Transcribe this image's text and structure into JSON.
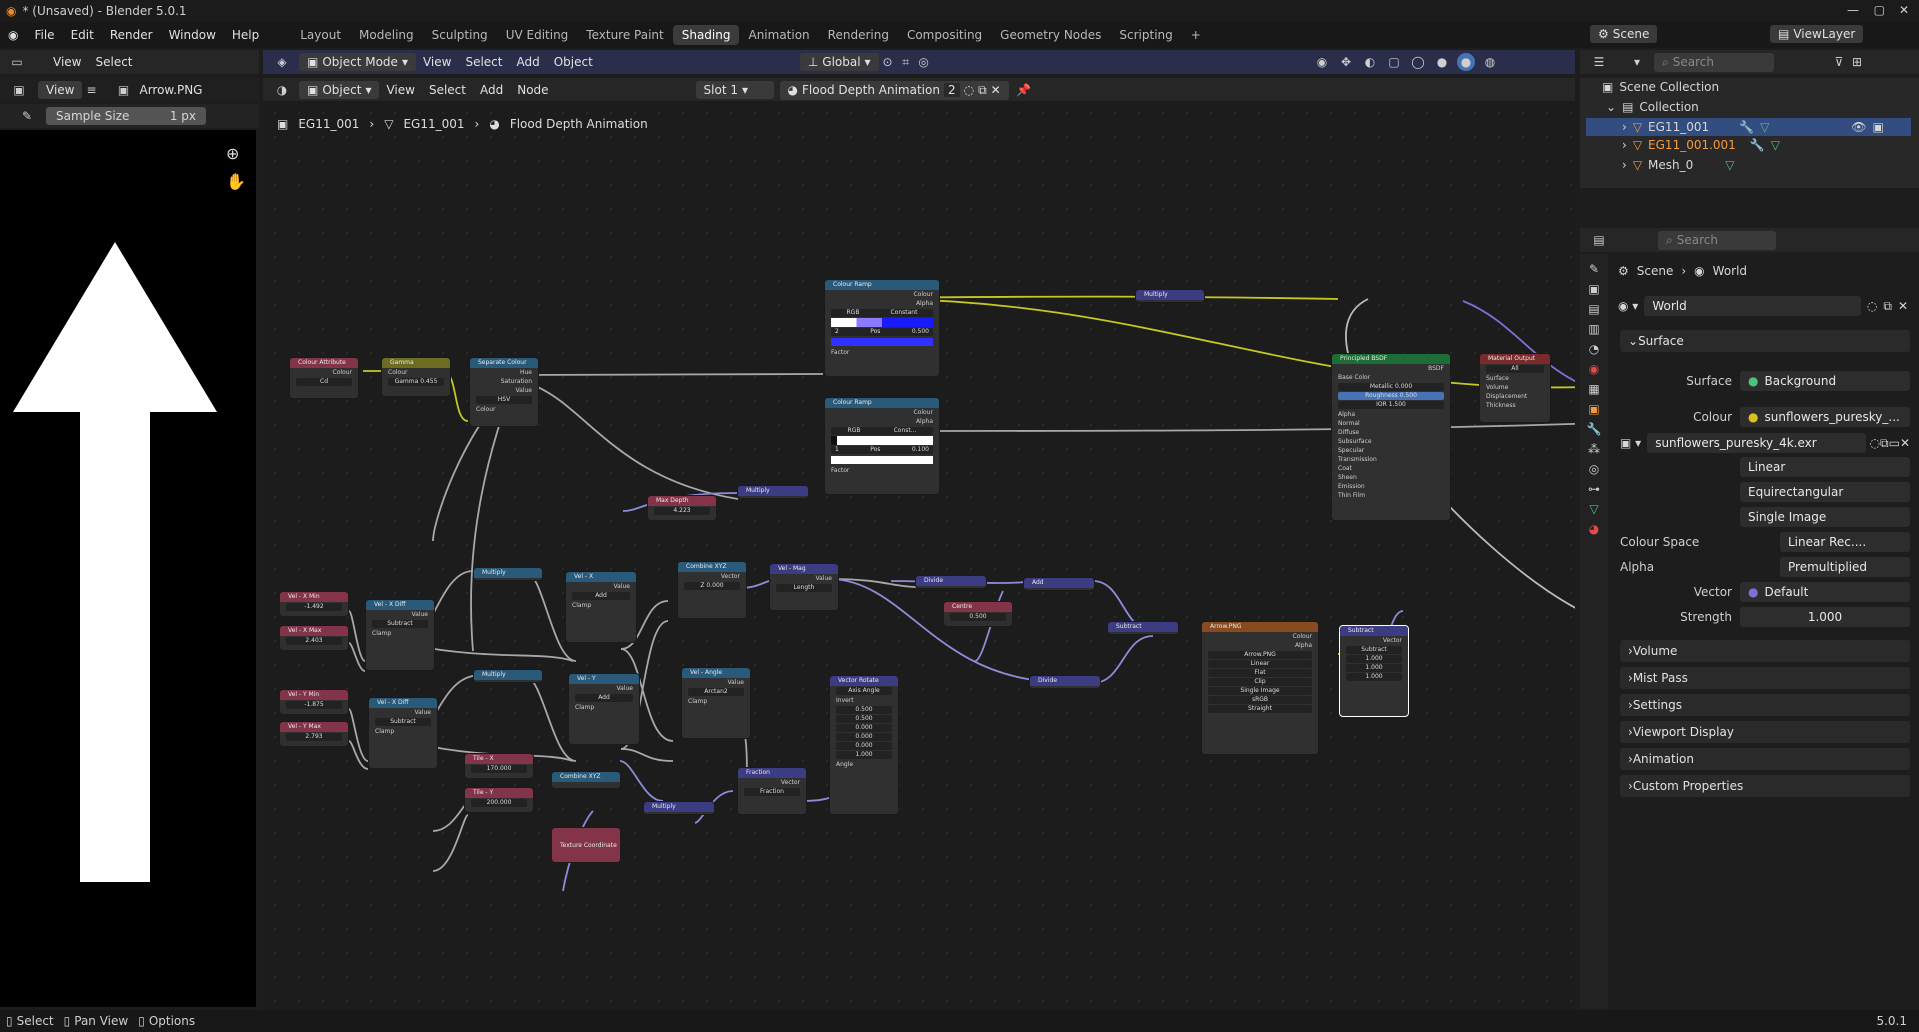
{
  "window_title": "* (Unsaved) - Blender 5.0.1",
  "menu": [
    "File",
    "Edit",
    "Render",
    "Window",
    "Help"
  ],
  "workspaces": [
    "Layout",
    "Modeling",
    "Sculpting",
    "UV Editing",
    "Texture Paint",
    "Shading",
    "Animation",
    "Rendering",
    "Compositing",
    "Geometry Nodes",
    "Scripting"
  ],
  "active_workspace": "Shading",
  "top_right": {
    "scene": "Scene",
    "view_layer": "ViewLayer"
  },
  "image_editor": {
    "header": {
      "view": "View",
      "select": "Select"
    },
    "sub_header": {
      "view": "View",
      "image_name": "Arrow.PNG"
    },
    "sample_size_label": "Sample Size",
    "sample_size_value": "1 px"
  },
  "viewport_header": {
    "mode": "Object Mode",
    "menus": [
      "View",
      "Select",
      "Add",
      "Object"
    ],
    "orientation": "Global"
  },
  "node_header": {
    "type": "Object",
    "menus": [
      "View",
      "Select",
      "Add",
      "Node"
    ],
    "slot": "Slot 1",
    "material": "Flood Depth Animation",
    "users": "2"
  },
  "breadcrumb": [
    "EG11_001",
    "EG11_001",
    "Flood Depth Animation"
  ],
  "nodes": {
    "colour_attribute": {
      "title": "Colour Attribute",
      "out1": "Colour",
      "out2": "Alpha",
      "field": "Cd"
    },
    "gamma": {
      "title": "Gamma",
      "in": "Colour",
      "gamma": "Gamma 0.455"
    },
    "separate_colour": {
      "title": "Separate Colour",
      "out1": "Hue",
      "out2": "Saturation",
      "out3": "Value",
      "mode": "HSV",
      "in": "Colour"
    },
    "colour_ramp_1": {
      "title": "Colour Ramp",
      "out1": "Colour",
      "out2": "Alpha",
      "mode": "RGB",
      "interp": "Constant",
      "pos_index": "2",
      "pos_label": "Pos",
      "pos_value": "0.500",
      "in": "Factor"
    },
    "colour_ramp_2": {
      "title": "Colour Ramp",
      "out1": "Colour",
      "out2": "Alpha",
      "mode": "RGB",
      "interp": "Const...",
      "pos_index": "1",
      "pos_label": "Pos",
      "pos_value": "0.100",
      "in": "Factor"
    },
    "multiply_top": {
      "title": "Multiply"
    },
    "principled": {
      "title": "Principled BSDF",
      "out": "BSDF",
      "rows": [
        "Base Color",
        "Metallic 0.000",
        "Roughness 0.500",
        "IOR 1.500",
        "Alpha",
        "Normal",
        "Diffuse",
        "Subsurface",
        "Specular",
        "Transmission",
        "Coat",
        "Sheen",
        "Emission",
        "Thin Film"
      ]
    },
    "material_output": {
      "title": "Material Output",
      "target": "All",
      "rows": [
        "Surface",
        "Volume",
        "Displacement",
        "Thickness"
      ]
    },
    "max_depth": {
      "title": "Max Depth",
      "value": "4.223"
    },
    "multiply_mid": {
      "title": "Multiply"
    },
    "vel_x_min": {
      "title": "Vel - X Min",
      "value": "-1.492"
    },
    "vel_x_max": {
      "title": "Vel - X Max",
      "value": "2.403"
    },
    "vel_y_min": {
      "title": "Vel - Y Min",
      "value": "-1.875"
    },
    "vel_y_max": {
      "title": "Vel - Y Max",
      "value": "2.793"
    },
    "vel_x_diff": {
      "title": "Vel - X Diff",
      "op": "Subtract",
      "clamp": "Clamp",
      "out": "Value"
    },
    "vel_y_diff": {
      "title": "Vel - X Diff",
      "op": "Subtract",
      "clamp": "Clamp",
      "out": "Value"
    },
    "multiply_a": {
      "title": "Multiply"
    },
    "multiply_b": {
      "title": "Multiply"
    },
    "vel_x": {
      "title": "Vel - X",
      "op": "Add",
      "clamp": "Clamp",
      "out": "Value"
    },
    "vel_y": {
      "title": "Vel - Y",
      "op": "Add",
      "clamp": "Clamp",
      "out": "Value"
    },
    "combine_xyz_1": {
      "title": "Combine XYZ",
      "out": "Vector",
      "z": "Z 0.000"
    },
    "vel_mag": {
      "title": "Vel - Mag",
      "op": "Length",
      "out": "Value"
    },
    "vel_angle": {
      "title": "Vel - Angle",
      "op": "Arctan2",
      "clamp": "Clamp",
      "out": "Value"
    },
    "tile_x": {
      "title": "Tile - X",
      "value": "170.000"
    },
    "tile_y": {
      "title": "Tile - Y",
      "value": "200.000"
    },
    "combine_xyz_2": {
      "title": "Combine XYZ"
    },
    "texture_coordinate": {
      "title": "Texture Coordinate"
    },
    "multiply_c": {
      "title": "Multiply"
    },
    "fraction": {
      "title": "Fraction",
      "op": "Fraction",
      "out": "Vector"
    },
    "vector_rotate": {
      "title": "Vector Rotate",
      "type": "Axis Angle",
      "invert": "Invert",
      "rows": [
        "0.500",
        "0.500",
        "0.000",
        "0.000",
        "0.000",
        "1.000"
      ],
      "angle": "Angle"
    },
    "divide_1": {
      "title": "Divide"
    },
    "centre": {
      "title": "Centre",
      "value": "0.500"
    },
    "add": {
      "title": "Add"
    },
    "divide_2": {
      "title": "Divide"
    },
    "subtract_1": {
      "title": "Subtract"
    },
    "arrow_png": {
      "title": "Arrow.PNG",
      "out1": "Colour",
      "out2": "Alpha",
      "rows": [
        "Linear",
        "Flat",
        "Clip",
        "Single Image"
      ],
      "colour_space": "sRGB",
      "alpha_mode": "Straight"
    },
    "subtract_2": {
      "title": "Subtract",
      "out": "Vector",
      "op": "Subtract",
      "rows": [
        "1.000",
        "1.000",
        "1.000"
      ]
    }
  },
  "outliner": {
    "search_placeholder": "Search",
    "root": "Scene Collection",
    "collection": "Collection",
    "items": [
      "EG11_001",
      "EG11_001.001",
      "Mesh_0"
    ]
  },
  "properties": {
    "search_placeholder": "Search",
    "breadcrumb": [
      "Scene",
      "World"
    ],
    "world_name": "World",
    "surface_section": "Surface",
    "surface_label": "Surface",
    "surface_value": "Background",
    "colour_label": "Colour",
    "colour_value": "sunflowers_puresky_...",
    "image_name": "sunflowers_puresky_4k.exr",
    "interp": "Linear",
    "projection": "Equirectangular",
    "source": "Single Image",
    "colour_space_label": "Colour Space",
    "colour_space_value": "Linear Rec....",
    "alpha_label": "Alpha",
    "alpha_value": "Premultiplied",
    "vector_label": "Vector",
    "vector_value": "Default",
    "strength_label": "Strength",
    "strength_value": "1.000",
    "sections": [
      "Volume",
      "Mist Pass",
      "Settings",
      "Viewport Display",
      "Animation",
      "Custom Properties"
    ]
  },
  "status_bar": {
    "select": "Select",
    "pan": "Pan View",
    "options": "Options",
    "version": "5.0.1"
  }
}
